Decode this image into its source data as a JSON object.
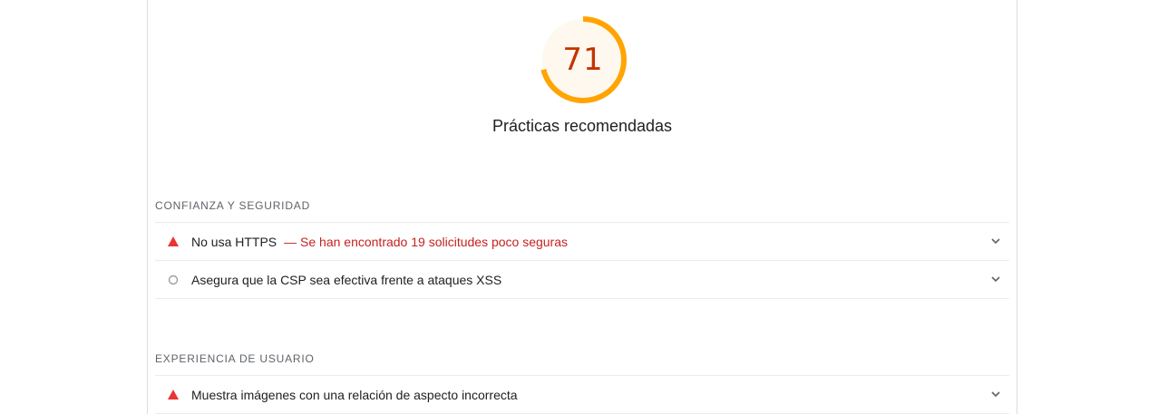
{
  "score": {
    "value": "71",
    "fraction": 0.71,
    "ring_color": "#ffa400",
    "fill_color": "#fff8ee",
    "text_color": "#c33300"
  },
  "category": {
    "title": "Prácticas recomendadas"
  },
  "groups": [
    {
      "title": "CONFIANZA Y SEGURIDAD",
      "audits": [
        {
          "status_icon": "fail-triangle-icon",
          "title": "No usa HTTPS",
          "display_value": "— Se han encontrado 19 solicitudes poco seguras"
        },
        {
          "status_icon": "informative-circle-icon",
          "title": "Asegura que la CSP sea efectiva frente a ataques XSS",
          "display_value": ""
        }
      ]
    },
    {
      "title": "EXPERIENCIA DE USUARIO",
      "audits": [
        {
          "status_icon": "fail-triangle-icon",
          "title": "Muestra imágenes con una relación de aspecto incorrecta",
          "display_value": ""
        }
      ]
    }
  ],
  "colors": {
    "fail": "#eb3434",
    "informative": "#9e9e9e"
  }
}
